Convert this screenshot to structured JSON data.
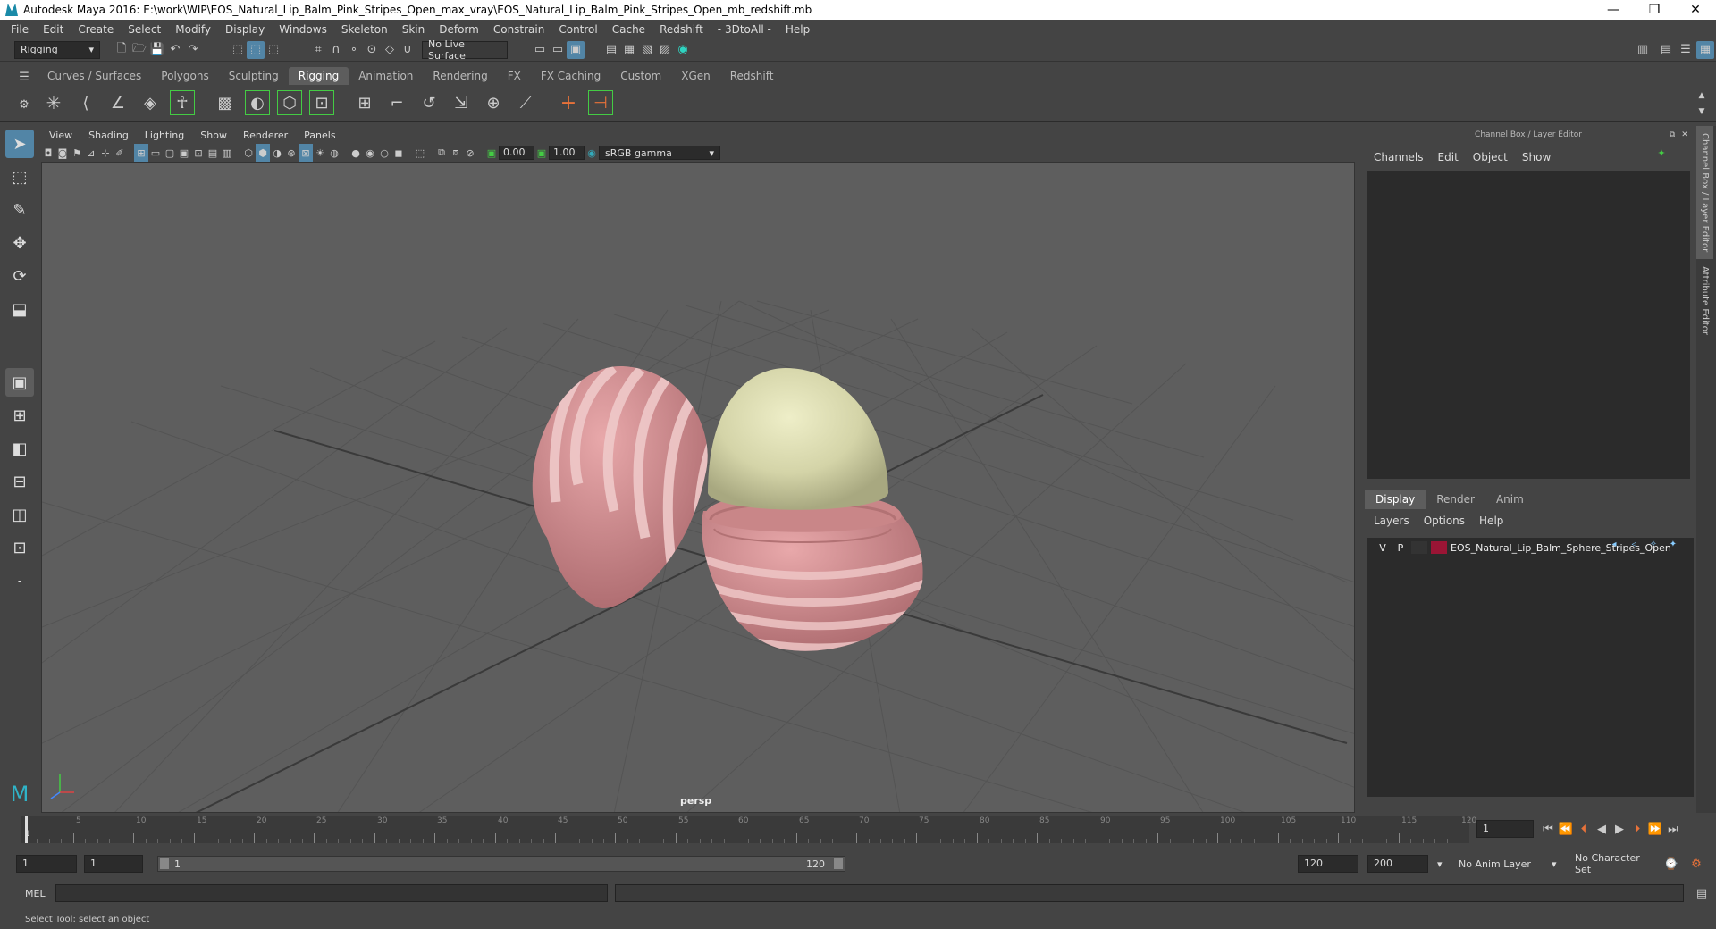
{
  "window": {
    "title": "Autodesk Maya 2016: E:\\work\\WIP\\EOS_Natural_Lip_Balm_Pink_Stripes_Open_max_vray\\EOS_Natural_Lip_Balm_Pink_Stripes_Open_mb_redshift.mb",
    "controls": {
      "minimize": "—",
      "restore": "❐",
      "close": "✕"
    }
  },
  "menubar": [
    "File",
    "Edit",
    "Create",
    "Select",
    "Modify",
    "Display",
    "Windows",
    "Skeleton",
    "Skin",
    "Deform",
    "Constrain",
    "Control",
    "Cache",
    "Redshift",
    "- 3DtoAll -",
    "Help"
  ],
  "statusline": {
    "menu_set": "Rigging",
    "live_surface": "No Live Surface"
  },
  "shelf": {
    "tabs": [
      "Curves / Surfaces",
      "Polygons",
      "Sculpting",
      "Rigging",
      "Animation",
      "Rendering",
      "FX",
      "FX Caching",
      "Custom",
      "XGen",
      "Redshift"
    ],
    "active_tab": "Rigging"
  },
  "viewport": {
    "menu": [
      "View",
      "Shading",
      "Lighting",
      "Show",
      "Renderer",
      "Panels"
    ],
    "exposure": "0.00",
    "gamma": "1.00",
    "color_space": "sRGB gamma",
    "camera": "persp"
  },
  "channel_box": {
    "header": "Channel Box / Layer Editor",
    "menu": [
      "Channels",
      "Edit",
      "Object",
      "Show"
    ]
  },
  "layer_editor": {
    "tabs": [
      "Display",
      "Render",
      "Anim"
    ],
    "active_tab": "Display",
    "menu": [
      "Layers",
      "Options",
      "Help"
    ],
    "layers": [
      {
        "v": "V",
        "p": "P",
        "color": "#9a1535",
        "name": "EOS_Natural_Lip_Balm_Sphere_Stripes_Open"
      }
    ]
  },
  "side_tabs": [
    "Channel Box / Layer Editor",
    "Attribute Editor"
  ],
  "timeline": {
    "ticks": [
      5,
      10,
      15,
      20,
      25,
      30,
      35,
      40,
      45,
      50,
      55,
      60,
      65,
      70,
      75,
      80,
      85,
      90,
      95,
      100,
      105,
      110,
      115,
      120
    ],
    "first_label": "1",
    "current_frame": "1"
  },
  "range": {
    "start": "1",
    "playback_start": "1",
    "slider_start": "1",
    "slider_end": "120",
    "playback_end": "120",
    "end": "200",
    "anim_layer": "No Anim Layer",
    "character_set": "No Character Set"
  },
  "command_line": {
    "label": "MEL"
  },
  "help_line": "Select Tool: select an object"
}
